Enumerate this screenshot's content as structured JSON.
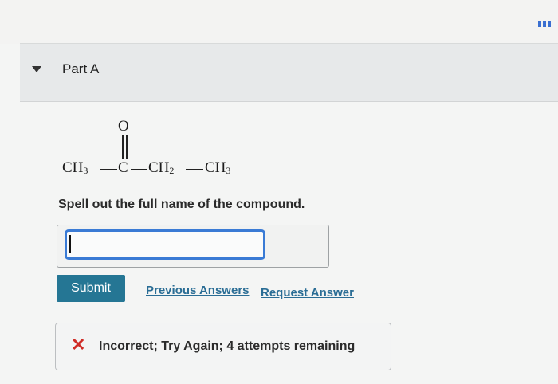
{
  "part": {
    "title": "Part A"
  },
  "compound": {
    "oxygen": "O",
    "ch3_left": "CH",
    "ch3_left_sub": "3",
    "carbon": "C",
    "ch2": "CH",
    "ch2_sub": "2",
    "ch3_right": "CH",
    "ch3_right_sub": "3"
  },
  "question": {
    "prompt": "Spell out the full name of the compound."
  },
  "answer": {
    "value": ""
  },
  "actions": {
    "submit_label": "Submit",
    "previous_answers_label": "Previous Answers",
    "request_answer_label": "Request Answer"
  },
  "feedback": {
    "icon": "x-icon",
    "text": "Incorrect; Try Again; 4 attempts remaining",
    "color": "#cf2c26"
  },
  "colors": {
    "accent": "#257694",
    "link": "#2a6d95",
    "input_focus": "#3a7bd5"
  }
}
